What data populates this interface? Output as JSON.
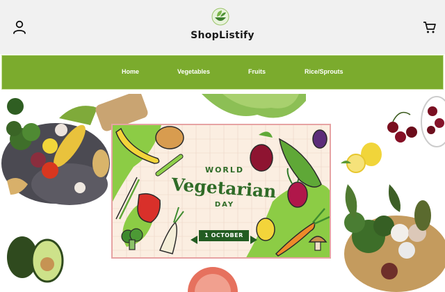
{
  "header": {
    "brand": "ShopListify",
    "logo_icon": "leaf-bowl-icon",
    "user_icon": "user-icon",
    "cart_icon": "cart-icon"
  },
  "nav": {
    "items": [
      {
        "label": "Home"
      },
      {
        "label": "Vegetables"
      },
      {
        "label": "Fruits"
      },
      {
        "label": "Rice/Sprouts"
      }
    ]
  },
  "hero": {
    "banner": {
      "line1": "WORLD",
      "line2": "Vegetarian",
      "line3": "DAY",
      "date": "1 OCTOBER"
    }
  },
  "colors": {
    "nav_green": "#7bab2d",
    "banner_green": "#2f6b27",
    "header_bg": "#f1f1f1"
  }
}
